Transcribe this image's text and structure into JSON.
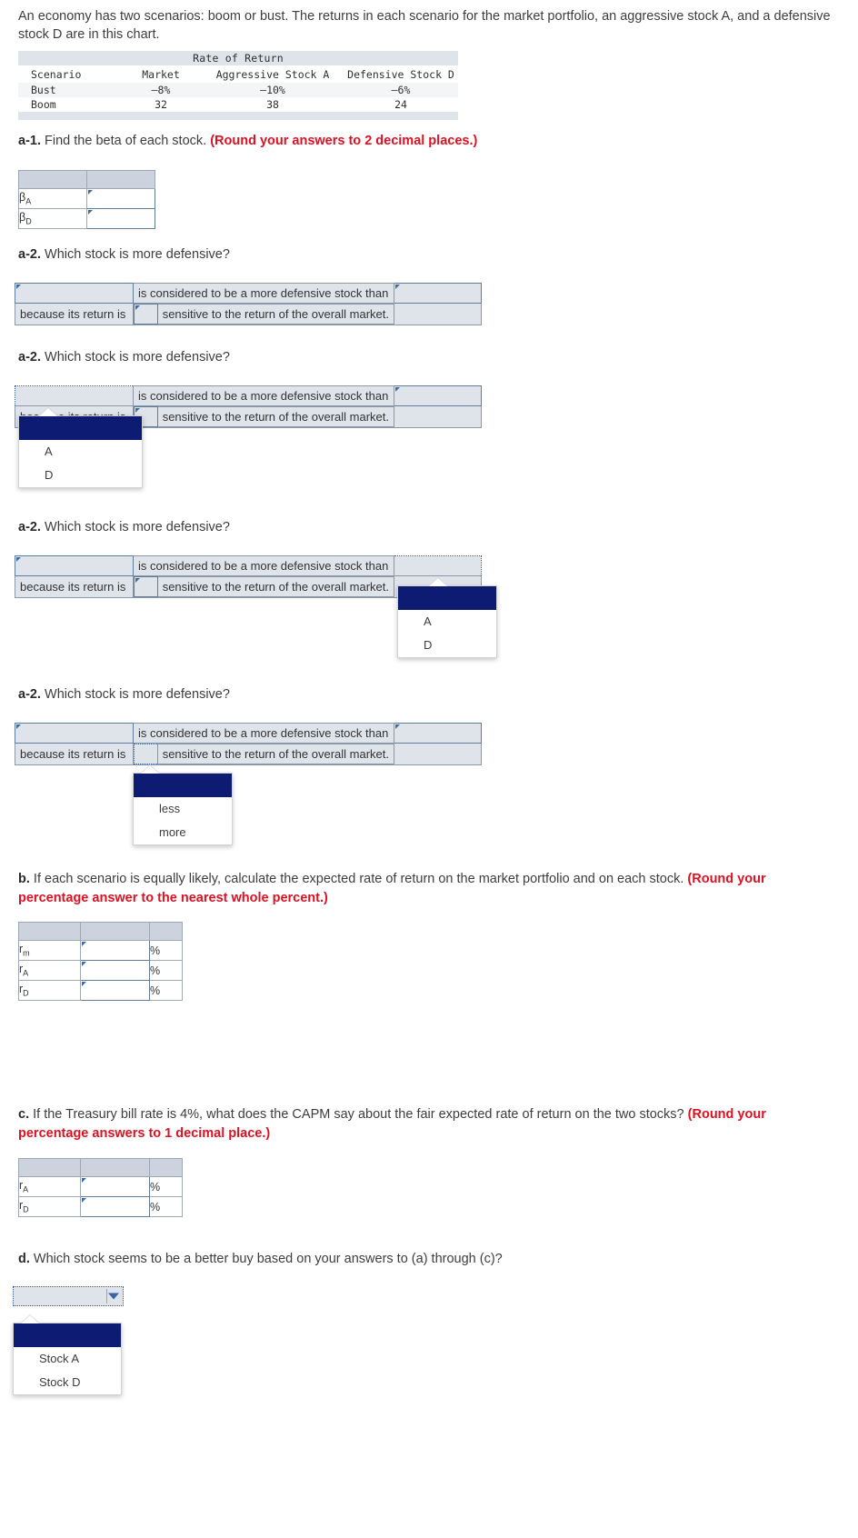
{
  "intro": {
    "text": "An economy has two scenarios: boom or bust. The returns in each scenario for the market portfolio, an aggressive stock A, and a defensive stock D are in this chart."
  },
  "chart_data": {
    "type": "table",
    "title": "Rate of Return",
    "columns": [
      "Scenario",
      "Market",
      "Aggressive Stock A",
      "Defensive Stock D"
    ],
    "rows": [
      [
        "Bust",
        "–8%",
        "–10%",
        "–6%"
      ],
      [
        "Boom",
        "32",
        "38",
        "24"
      ]
    ],
    "categories": [
      "Bust",
      "Boom"
    ],
    "series": [
      {
        "name": "Market",
        "values": [
          -8,
          32
        ]
      },
      {
        "name": "Aggressive Stock A",
        "values": [
          -10,
          38
        ]
      },
      {
        "name": "Defensive Stock D",
        "values": [
          -6,
          24
        ]
      }
    ],
    "xlabel": "Scenario",
    "ylabel": "Rate of Return"
  },
  "questions": {
    "a1": {
      "tag": "a-1.",
      "text": " Find the beta of each stock. ",
      "hint": "(Round your answers to 2 decimal places.)",
      "rows": [
        {
          "label": "β",
          "sub": "A",
          "value": ""
        },
        {
          "label": "β",
          "sub": "D",
          "value": ""
        }
      ]
    },
    "a2": {
      "tag": "a-2.",
      "text": " Which stock is more defensive?",
      "sentence": {
        "mid_top": "is considered to be a more defensive stock than",
        "lead_bottom": "because its return is",
        "tail_bottom": "sensitive to the return of the overall market."
      },
      "stock_options": [
        "A",
        "D"
      ],
      "degree_options": [
        "less",
        "more"
      ],
      "selected_stock": "",
      "selected_degree": ""
    },
    "b": {
      "tag": "b.",
      "text": " If each scenario is equally likely, calculate the expected rate of return on the market portfolio and on each stock. ",
      "hint": "(Round your percentage answer to the nearest whole percent.)",
      "rows": [
        {
          "label": "r",
          "sub": "m",
          "value": "",
          "unit": "%"
        },
        {
          "label": "r",
          "sub": "A",
          "value": "",
          "unit": "%"
        },
        {
          "label": "r",
          "sub": "D",
          "value": "",
          "unit": "%"
        }
      ]
    },
    "c": {
      "tag": "c.",
      "text": " If the Treasury bill rate is 4%, what does the CAPM say about the fair expected rate of return on the two stocks? ",
      "hint": "(Round your percentage answers to 1 decimal place.)",
      "rows": [
        {
          "label": "r",
          "sub": "A",
          "value": "",
          "unit": "%"
        },
        {
          "label": "r",
          "sub": "D",
          "value": "",
          "unit": "%"
        }
      ]
    },
    "d": {
      "tag": "d.",
      "text": " Which stock seems to be a better buy based on your answers to (a) through (c)?",
      "options": [
        "Stock A",
        "Stock D"
      ],
      "selected": ""
    }
  },
  "colors": {
    "hint": "#dd1122",
    "header_fill": "#ccd3df",
    "sentence_fill": "#dfe3ea",
    "input_border": "#5f7c99",
    "dropdown_selected": "#0d1c72"
  }
}
